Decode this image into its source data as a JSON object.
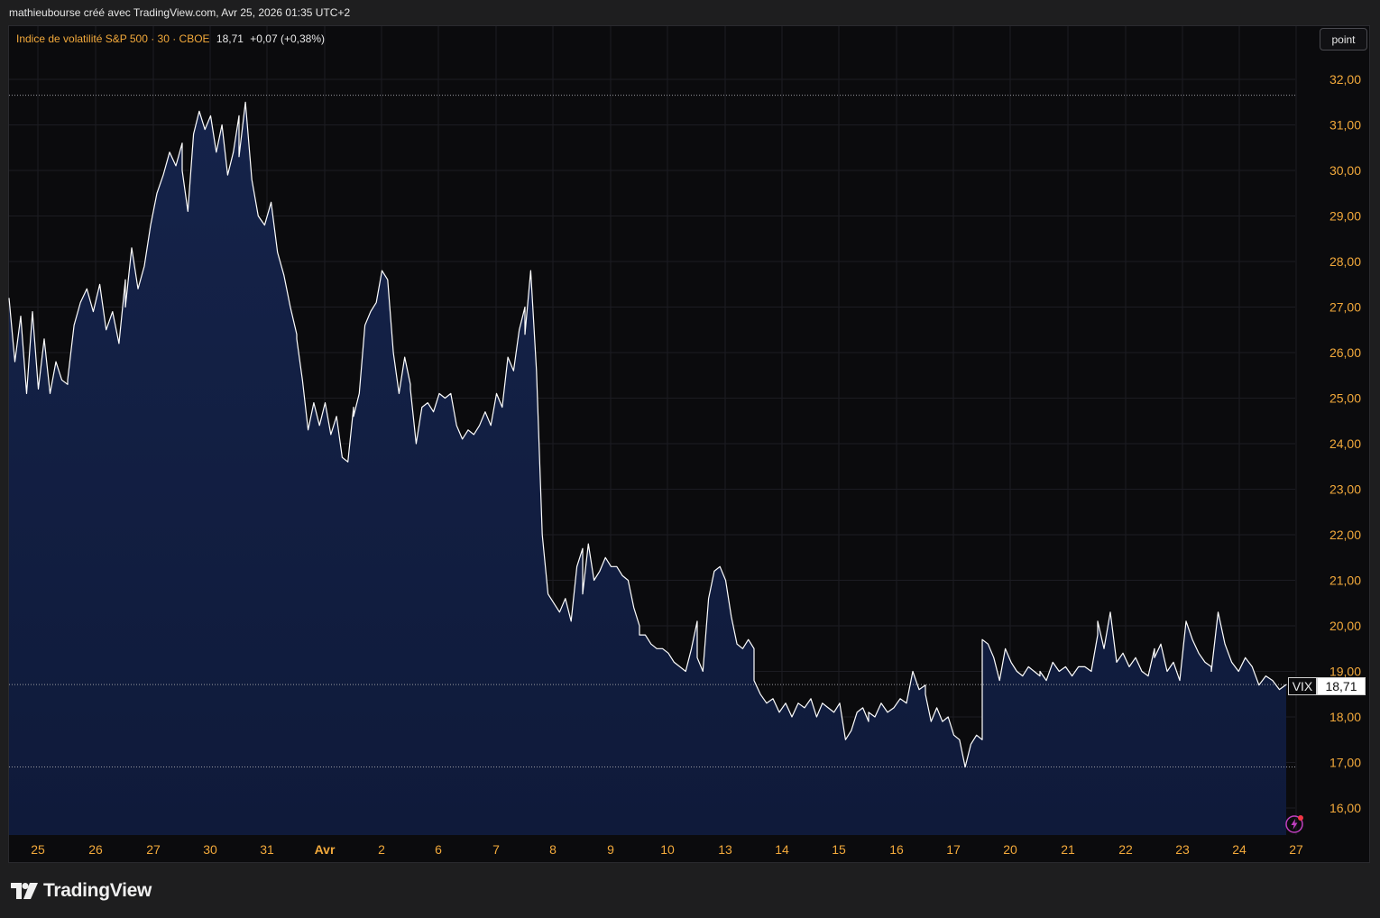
{
  "header": {
    "caption": "mathieubourse créé avec TradingView.com, Avr 25, 2026 01:35 UTC+2"
  },
  "legend": {
    "title": "Indice de volatilité S&P 500 · 30 · CBOE",
    "last": "18,71",
    "change": "+0,07 (+0,38%)"
  },
  "toolbar": {
    "scale_button": "point"
  },
  "price_tag": {
    "symbol": "VIX",
    "value": "18,71"
  },
  "footer": {
    "brand": "TradingView"
  },
  "colors": {
    "accent": "#f2a93b",
    "line": "#ffffff",
    "area_top": "#142045",
    "area_bottom": "#0f1a38",
    "background": "#0b0b0d"
  },
  "icons": [
    "tradingview-logo-icon",
    "lightning-bolt-icon"
  ],
  "chart_data": {
    "type": "area",
    "ylim": [
      15.4,
      32.8
    ],
    "yticks": [
      {
        "value": 32,
        "label": "32,00"
      },
      {
        "value": 31,
        "label": "31,00"
      },
      {
        "value": 30,
        "label": "30,00"
      },
      {
        "value": 29,
        "label": "29,00"
      },
      {
        "value": 28,
        "label": "28,00"
      },
      {
        "value": 27,
        "label": "27,00"
      },
      {
        "value": 26,
        "label": "26,00"
      },
      {
        "value": 25,
        "label": "25,00"
      },
      {
        "value": 24,
        "label": "24,00"
      },
      {
        "value": 23,
        "label": "23,00"
      },
      {
        "value": 22,
        "label": "22,00"
      },
      {
        "value": 21,
        "label": "21,00"
      },
      {
        "value": 20,
        "label": "20,00"
      },
      {
        "value": 19,
        "label": "19,00"
      },
      {
        "value": 18,
        "label": "18,00"
      },
      {
        "value": 17,
        "label": "17,00"
      },
      {
        "value": 16,
        "label": "16,00"
      }
    ],
    "xticks": [
      "25",
      "26",
      "27",
      "30",
      "31",
      "Avr",
      "2",
      "6",
      "7",
      "8",
      "9",
      "10",
      "13",
      "14",
      "15",
      "16",
      "17",
      "20",
      "21",
      "22",
      "23",
      "24",
      "27"
    ],
    "bold_xticks": [
      "Avr"
    ],
    "reference_lines": [
      31.65,
      18.71,
      16.9
    ],
    "last_value": 18.71,
    "days": [
      {
        "label": "25",
        "values": [
          27.2,
          25.8,
          26.8,
          25.1,
          26.9,
          25.2,
          26.3,
          25.1,
          25.8,
          25.4,
          25.3
        ]
      },
      {
        "label": "26",
        "values": [
          25.4,
          26.6,
          27.1,
          27.4,
          26.9,
          27.5,
          26.5,
          26.9,
          26.2,
          27.6
        ]
      },
      {
        "label": "27",
        "values": [
          27.0,
          28.3,
          27.4,
          27.9,
          28.8,
          29.5,
          29.9,
          30.4,
          30.1,
          30.6
        ]
      },
      {
        "label": "30",
        "values": [
          30.0,
          29.1,
          30.8,
          31.3,
          30.9,
          31.2,
          30.4,
          31.0,
          29.9,
          30.4,
          31.2
        ]
      },
      {
        "label": "31",
        "values": [
          30.3,
          31.5,
          29.8,
          29.0,
          28.8,
          29.3,
          28.2,
          27.7,
          27.0,
          26.4
        ]
      },
      {
        "label": "Avr",
        "values": [
          26.3,
          25.4,
          24.3,
          24.9,
          24.4,
          24.9,
          24.2,
          24.6,
          23.7,
          23.6,
          24.8
        ]
      },
      {
        "label": "2",
        "values": [
          24.6,
          25.1,
          26.6,
          26.9,
          27.1,
          27.8,
          27.6,
          26.0,
          25.1,
          25.9,
          25.3
        ]
      },
      {
        "label": "6",
        "values": [
          25.2,
          24.0,
          24.8,
          24.9,
          24.7,
          25.1,
          25.0,
          25.1,
          24.4,
          24.1,
          24.3
        ]
      },
      {
        "label": "7",
        "values": [
          24.3,
          24.2,
          24.4,
          24.7,
          24.4,
          25.1,
          24.8,
          25.9,
          25.6,
          26.5,
          27.0
        ]
      },
      {
        "label": "8",
        "values": [
          26.4,
          27.8,
          25.6,
          22.0,
          20.7,
          20.5,
          20.3,
          20.6,
          20.1,
          21.3,
          21.7
        ]
      },
      {
        "label": "9",
        "values": [
          20.7,
          21.8,
          21.0,
          21.2,
          21.5,
          21.3,
          21.3,
          21.1,
          21.0,
          20.4,
          20.0
        ]
      },
      {
        "label": "10",
        "values": [
          19.8,
          19.8,
          19.6,
          19.5,
          19.5,
          19.4,
          19.2,
          19.1,
          19.0,
          19.5,
          20.1
        ]
      },
      {
        "label": "13",
        "values": [
          19.3,
          19.0,
          20.6,
          21.2,
          21.3,
          21.0,
          20.2,
          19.6,
          19.5,
          19.7,
          19.5
        ]
      },
      {
        "label": "14",
        "values": [
          18.8,
          18.5,
          18.3,
          18.4,
          18.1,
          18.3,
          18.0,
          18.3,
          18.2,
          18.4
        ]
      },
      {
        "label": "15",
        "values": [
          18.4,
          18.0,
          18.3,
          18.2,
          18.1,
          18.3,
          17.5,
          17.7,
          18.1,
          18.2,
          17.9
        ]
      },
      {
        "label": "16",
        "values": [
          18.1,
          18.0,
          18.3,
          18.1,
          18.2,
          18.4,
          18.3,
          19.0,
          18.6,
          18.7
        ]
      },
      {
        "label": "17",
        "values": [
          18.5,
          17.9,
          18.2,
          17.9,
          18.0,
          17.6,
          17.5,
          16.9,
          17.4,
          17.6,
          17.5
        ]
      },
      {
        "label": "20",
        "values": [
          19.7,
          19.6,
          19.3,
          18.8,
          19.5,
          19.2,
          19.0,
          18.9,
          19.1,
          19.0,
          18.9
        ]
      },
      {
        "label": "21",
        "values": [
          19.0,
          18.8,
          19.2,
          19.0,
          19.1,
          18.9,
          19.1,
          19.1,
          19.0,
          19.8
        ]
      },
      {
        "label": "22",
        "values": [
          20.1,
          19.5,
          20.3,
          19.2,
          19.4,
          19.1,
          19.3,
          19.0,
          18.9,
          19.5
        ]
      },
      {
        "label": "23",
        "values": [
          19.3,
          19.6,
          19.0,
          19.2,
          18.8,
          20.1,
          19.7,
          19.4,
          19.2,
          19.1
        ]
      },
      {
        "label": "24",
        "values": [
          19.0,
          20.3,
          19.6,
          19.2,
          19.0,
          19.3,
          19.1,
          18.7,
          18.9,
          18.8,
          18.6,
          18.71
        ]
      }
    ]
  }
}
